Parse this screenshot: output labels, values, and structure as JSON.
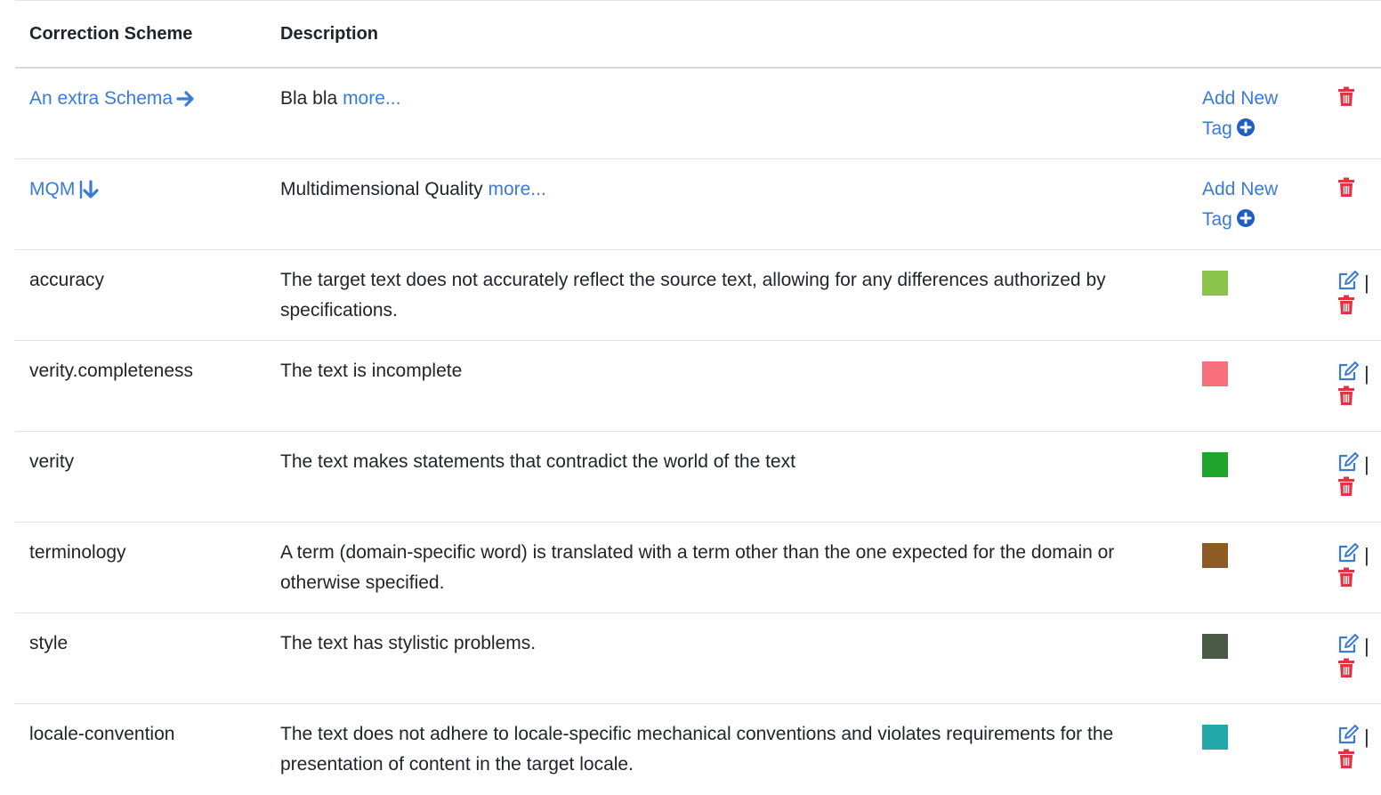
{
  "header": {
    "scheme_label": "Correction Scheme",
    "description_label": "Description"
  },
  "schemes": [
    {
      "name": "An extra Schema",
      "arrow_icon": "arrow-right-icon",
      "description": "Bla bla",
      "more_label": "more...",
      "add_tag_label_1": "Add New",
      "add_tag_label_2": "Tag"
    },
    {
      "name": "MQM",
      "arrow_icon": "arrow-down-icon",
      "description": "Multidimensional Quality",
      "more_label": "more...",
      "add_tag_label_1": "Add New",
      "add_tag_label_2": "Tag"
    }
  ],
  "tags": [
    {
      "name": "accuracy",
      "description": "The target text does not accurately reflect the source text, allowing for any differences authorized by specifications.",
      "color": "#8bc34a"
    },
    {
      "name": "verity.completeness",
      "description": "The text is incomplete",
      "color": "#f7707c"
    },
    {
      "name": "verity",
      "description": "The text makes statements that contradict the world of the text",
      "color": "#1fa62a"
    },
    {
      "name": "terminology",
      "description": "A term (domain-specific word) is translated with a term other than the one expected for the domain or otherwise specified.",
      "color": "#8f5b25"
    },
    {
      "name": "style",
      "description": "The text has stylistic problems.",
      "color": "#4a5a45"
    },
    {
      "name": "locale-convention",
      "description": "The text does not adhere to locale-specific mechanical conventions and violates requirements for the presentation of content in the target locale.",
      "color": "#22a8a8"
    }
  ],
  "separator": "|",
  "colors": {
    "link": "#3a7bd5",
    "danger": "#dc3545"
  },
  "icons": {
    "edit": "edit-icon",
    "trash": "trash-icon",
    "plus": "plus-circle-icon"
  }
}
